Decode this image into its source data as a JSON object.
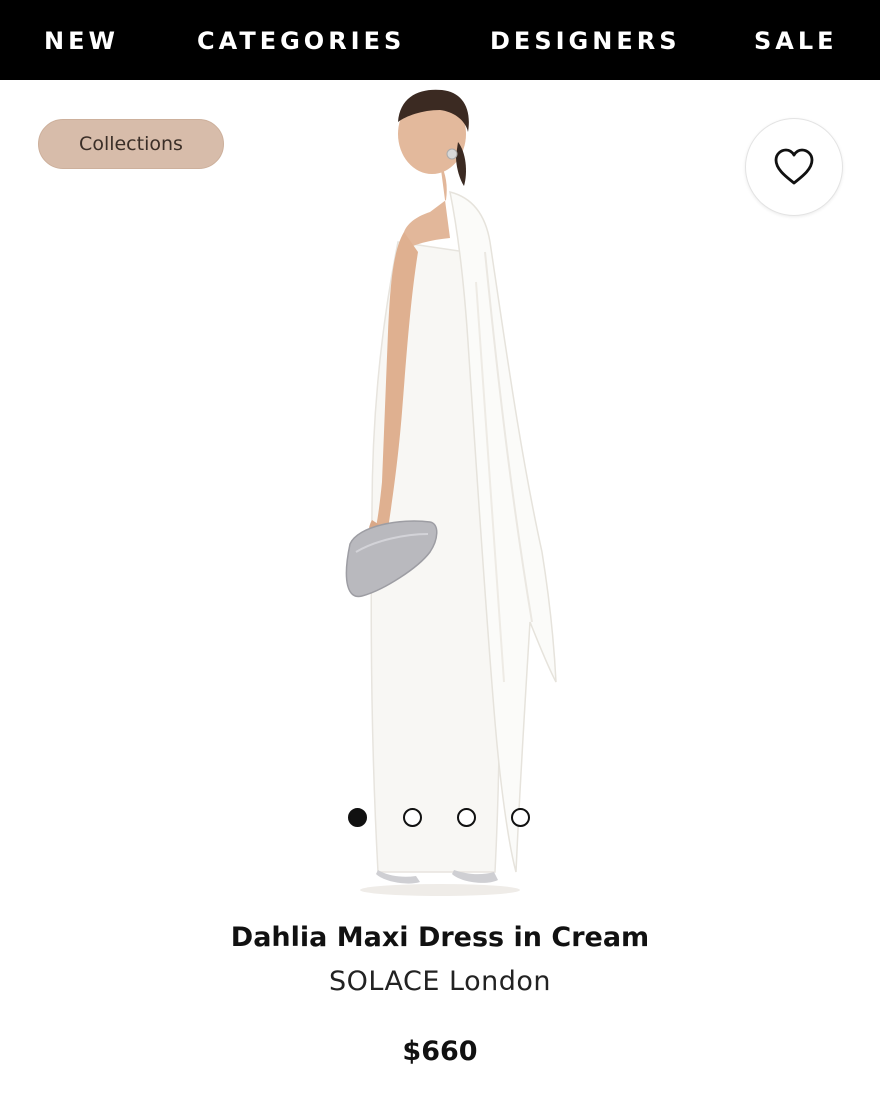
{
  "nav": {
    "items": [
      {
        "label": "NEW"
      },
      {
        "label": "CATEGORIES"
      },
      {
        "label": "DESIGNERS"
      },
      {
        "label": "SALE"
      }
    ]
  },
  "chip": {
    "label": "Collections"
  },
  "favorite": {
    "icon": "heart-icon",
    "active": false
  },
  "gallery": {
    "image_count": 4,
    "current_index": 0
  },
  "product": {
    "title": "Dahlia Maxi Dress in Cream",
    "brand": "SOLACE London",
    "price": "$660"
  },
  "colors": {
    "nav_bg": "#000000",
    "nav_text": "#ffffff",
    "chip_bg": "#d7bcaa",
    "text": "#111111"
  }
}
